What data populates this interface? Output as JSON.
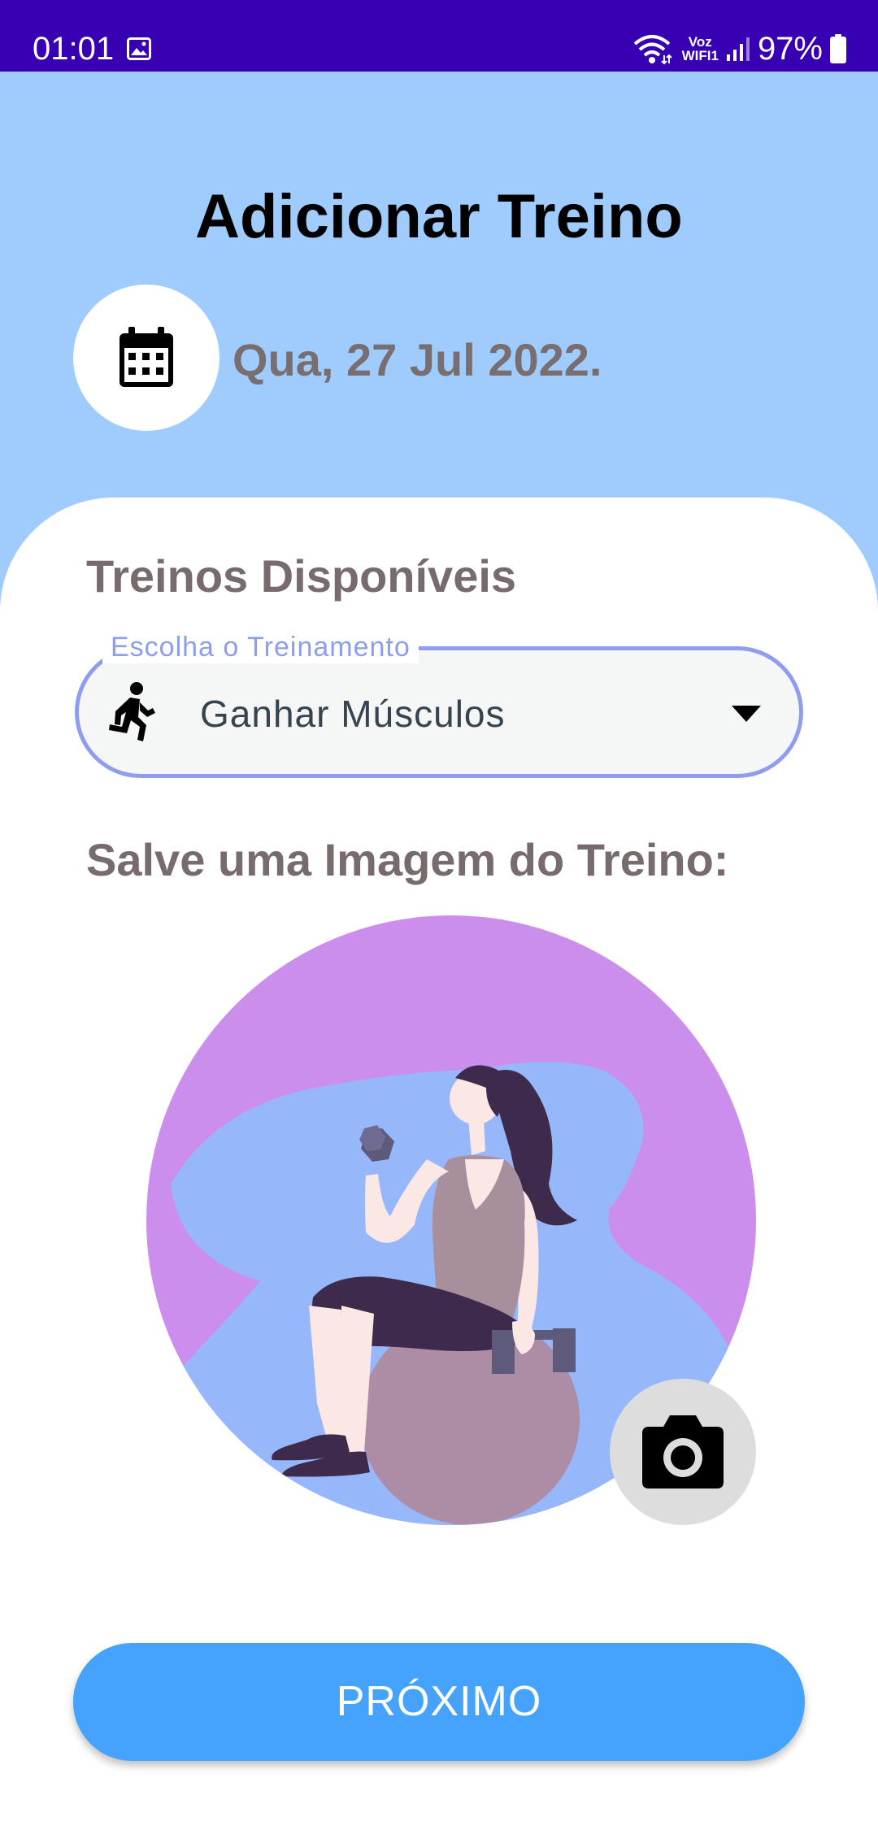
{
  "status_bar": {
    "time": "01:01",
    "network_label_top": "Voz",
    "network_label_bottom": "WIFI1",
    "battery": "97%",
    "icons": [
      "image-icon",
      "wifi-icon",
      "signal-icon",
      "battery-icon"
    ]
  },
  "header": {
    "title": "Adicionar Treino",
    "date": "Qua, 27 Jul 2022.",
    "calendar_icon": "calendar-icon"
  },
  "workouts": {
    "section_title": "Treinos Disponíveis",
    "field_label": "Escolha o Treinamento",
    "selected": "Ganhar Músculos",
    "field_icon": "directions-run-icon",
    "dropdown_icon": "caret-down-icon"
  },
  "image_section": {
    "title": "Salve uma Imagem do Treino:",
    "camera_icon": "camera-icon"
  },
  "footer": {
    "next_label": "PRÓXIMO"
  },
  "colors": {
    "status_bar": "#3700b3",
    "header_bg": "#a0cbfd",
    "accent_outline": "#8d9ef1",
    "button": "#46a3fd",
    "illustration_circle": "#cc8eec",
    "illustration_blob": "#97b7fb"
  }
}
